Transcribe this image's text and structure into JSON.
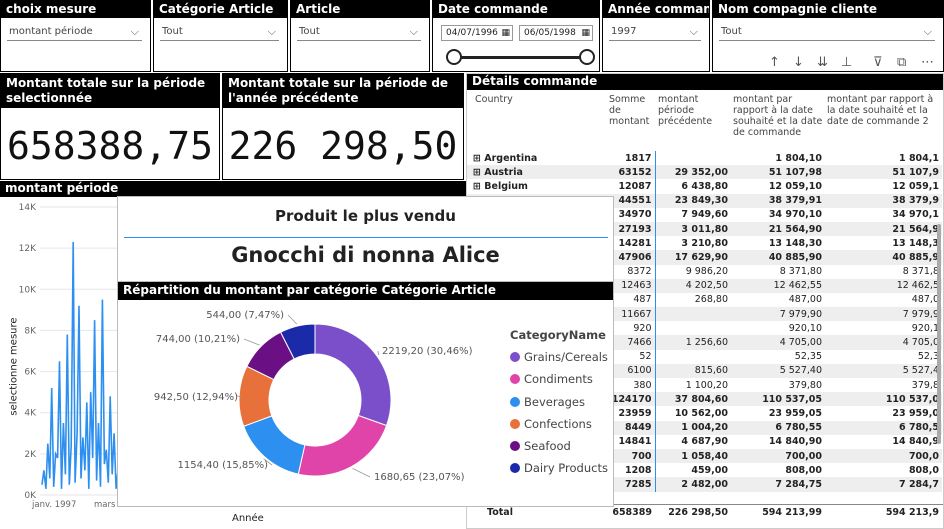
{
  "slicers": [
    {
      "title": "choix mesure",
      "value": "montant période"
    },
    {
      "title": "Catégorie Article",
      "value": "Tout"
    },
    {
      "title": "Article",
      "value": "Tout"
    },
    {
      "title": "Date commande",
      "start": "04/07/1996",
      "end": "06/05/1998"
    },
    {
      "title": "Année commande",
      "value": "1997"
    },
    {
      "title": "Nom compagnie cliente",
      "value": "Tout"
    }
  ],
  "cards": {
    "card1_title": "Montant totale sur la période selectionnée",
    "card1_value": "658388,75",
    "card2_title": "Montant totale sur la période de l'année précédente",
    "card2_value": "226 298,50"
  },
  "linechart": {
    "title": "montant période",
    "ylabel": "selectionne mesure",
    "xlabel": "Année",
    "ytick_labels": [
      "0K",
      "2K",
      "4K",
      "6K",
      "8K",
      "10K",
      "12K",
      "14K"
    ],
    "xtick_labels": [
      "janv. 1997",
      "mars"
    ]
  },
  "chart_data": {
    "type": "line",
    "ylim": [
      0,
      14000
    ],
    "x_ticks": [
      "janv. 1997",
      "mars"
    ],
    "values": [
      500,
      1200,
      300,
      2500,
      800,
      5200,
      400,
      2000,
      1800,
      6500,
      300,
      3500,
      1000,
      7800,
      500,
      2400,
      12300,
      600,
      3000,
      9200,
      800,
      2800,
      1200,
      4500,
      300,
      5000,
      1800,
      8500,
      700,
      3500,
      400,
      9500,
      1500,
      2200,
      600,
      4800,
      1000,
      3000,
      300,
      1200
    ]
  },
  "product": {
    "title": "Produit le plus vendu",
    "name": "Gnocchi di nonna Alice"
  },
  "donut": {
    "title": "Répartition du montant par catégorie Catégorie Article",
    "legend_title": "CategoryName",
    "slices": [
      {
        "name": "Grains/Cereals",
        "value": 2219.2,
        "label": "2219,20 (30,46%)",
        "color": "#7b4fc9"
      },
      {
        "name": "Condiments",
        "value": 1680.65,
        "label": "1680,65 (23,07%)",
        "color": "#e044a8"
      },
      {
        "name": "Beverages",
        "value": 1154.4,
        "label": "1154,40 (15,85%)",
        "color": "#2d8ff0"
      },
      {
        "name": "Confections",
        "value": 942.5,
        "label": "942,50 (12,94%)",
        "color": "#e8703a"
      },
      {
        "name": "Seafood",
        "value": 744.0,
        "label": "744,00 (10,21%)",
        "color": "#6b0f84"
      },
      {
        "name": "Dairy Products",
        "value": 544.0,
        "label": "544,00 (7,47%)",
        "color": "#1a2aa8"
      }
    ]
  },
  "table": {
    "title": "Détails commande",
    "headers": [
      "Country",
      "Somme de montant",
      "montant période précédente",
      "montant par rapport à la date souhaité et la date de commande",
      "montant par rapport à la date souhaité et la date de commande 2"
    ],
    "rows": [
      [
        "Argentina",
        "1817",
        "",
        "1 804,10",
        "1 804,1"
      ],
      [
        "Austria",
        "63152",
        "29 352,00",
        "51 107,98",
        "51 107,9"
      ],
      [
        "Belgium",
        "12087",
        "6 438,80",
        "12 059,10",
        "12 059,1"
      ],
      [
        "",
        "44551",
        "23 849,30",
        "38 379,91",
        "38 379,9"
      ],
      [
        "",
        "34970",
        "7 949,60",
        "34 970,10",
        "34 970,1"
      ],
      [
        "",
        "27193",
        "3 011,80",
        "21 564,90",
        "21 564,9"
      ],
      [
        "",
        "14281",
        "3 210,80",
        "13 148,30",
        "13 148,3"
      ],
      [
        "",
        "47906",
        "17 629,90",
        "40 885,90",
        "40 885,9"
      ],
      [
        "",
        "8372",
        "9 986,20",
        "8 371,80",
        "8 371,8"
      ],
      [
        "",
        "12463",
        "4 202,50",
        "12 462,55",
        "12 462,5"
      ],
      [
        "",
        "487",
        "268,80",
        "487,00",
        "487,0"
      ],
      [
        "",
        "11667",
        "",
        "7 979,90",
        "7 979,9"
      ],
      [
        "",
        "920",
        "",
        "920,10",
        "920,1"
      ],
      [
        "",
        "7466",
        "1 256,60",
        "4 705,00",
        "4 705,0"
      ],
      [
        "",
        "52",
        "",
        "52,35",
        "52,3"
      ],
      [
        "",
        "6100",
        "815,60",
        "5 527,40",
        "5 527,4"
      ],
      [
        "",
        "380",
        "1 100,20",
        "379,80",
        "379,8"
      ],
      [
        "",
        "124170",
        "37 804,60",
        "110 537,05",
        "110 537,0"
      ],
      [
        "",
        "23959",
        "10 562,00",
        "23 959,05",
        "23 959,0"
      ],
      [
        "",
        "8449",
        "1 004,20",
        "6 780,55",
        "6 780,5"
      ],
      [
        "",
        "14841",
        "4 687,90",
        "14 840,90",
        "14 840,9"
      ],
      [
        "",
        "700",
        "1 058,40",
        "700,00",
        "700,0"
      ],
      [
        "",
        "1208",
        "459,00",
        "808,00",
        "808,0"
      ],
      [
        "",
        "7285",
        "2 482,00",
        "7 284,75",
        "7 284,7"
      ]
    ],
    "total": [
      "Total",
      "658389",
      "226 298,50",
      "594 213,99",
      "594 213,9"
    ]
  }
}
